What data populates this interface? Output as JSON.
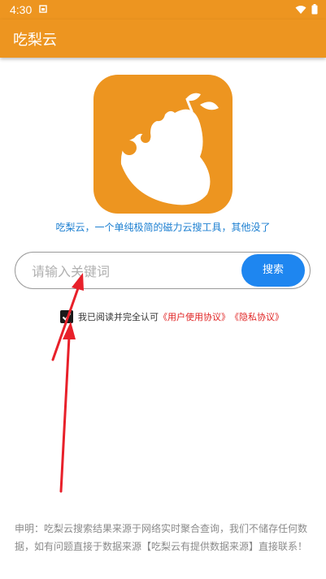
{
  "status_bar": {
    "time": "4:30"
  },
  "app_bar": {
    "title": "吃梨云"
  },
  "tagline": "吃梨云，一个单纯极简的磁力云搜工具，其他没了",
  "search": {
    "placeholder": "请输入关键词",
    "value": "",
    "button_label": "搜索"
  },
  "agreement": {
    "prefix": "我已阅读并完全认可",
    "user_agreement": "《用户使用协议》",
    "privacy_agreement": "《隐私协议》",
    "checked": true
  },
  "disclaimer": "申明：吃梨云搜索结果来源于网络实时聚合查询，我们不储存任何数据，如有问题直接于数据来源【吃梨云有提供数据来源】直接联系！",
  "colors": {
    "brand": "#ed9520",
    "accent": "#1e86f0",
    "link": "#e02424",
    "tagline": "#1c7fd1"
  }
}
